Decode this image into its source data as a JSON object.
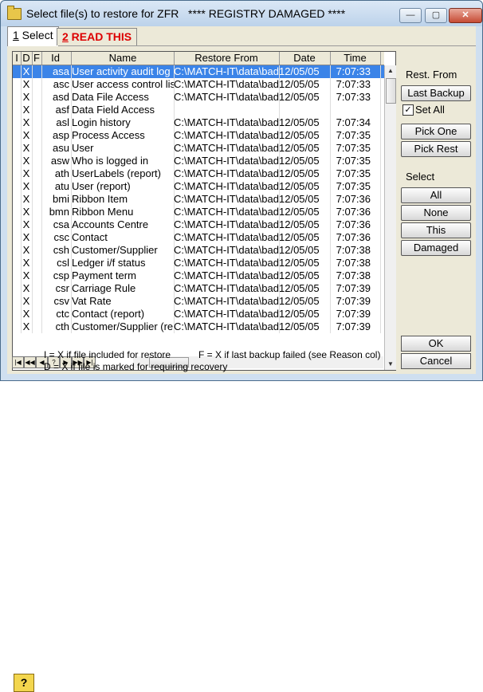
{
  "window": {
    "title": "Select file(s) to restore for ZFR   **** REGISTRY DAMAGED ****",
    "minimize": "—",
    "maximize": "▢",
    "close": "✕"
  },
  "tabs": [
    {
      "number": "1",
      "label": " Select"
    },
    {
      "number": "2",
      "label": " READ THIS"
    }
  ],
  "grid": {
    "headers": [
      "I",
      "D",
      "F",
      "Id",
      "Name",
      "Restore From",
      "Date",
      "Time"
    ],
    "rows": [
      {
        "i": "",
        "d": "X",
        "f": "",
        "id": "asa",
        "name": "User activity audit log",
        "from": "C:\\MATCH-IT\\data\\bad",
        "date": "12/05/05",
        "time": "7:07:33"
      },
      {
        "i": "",
        "d": "X",
        "f": "",
        "id": "asc",
        "name": "User access control list",
        "from": "C:\\MATCH-IT\\data\\bad",
        "date": "12/05/05",
        "time": "7:07:33"
      },
      {
        "i": "",
        "d": "X",
        "f": "",
        "id": "asd",
        "name": "Data File Access",
        "from": "C:\\MATCH-IT\\data\\bad",
        "date": "12/05/05",
        "time": "7:07:33"
      },
      {
        "i": "",
        "d": "X",
        "f": "",
        "id": "asf",
        "name": "Data Field Access",
        "from": "",
        "date": "",
        "time": ""
      },
      {
        "i": "",
        "d": "X",
        "f": "",
        "id": "asl",
        "name": "Login history",
        "from": "C:\\MATCH-IT\\data\\bad",
        "date": "12/05/05",
        "time": "7:07:34"
      },
      {
        "i": "",
        "d": "X",
        "f": "",
        "id": "asp",
        "name": "Process Access",
        "from": "C:\\MATCH-IT\\data\\bad",
        "date": "12/05/05",
        "time": "7:07:35"
      },
      {
        "i": "",
        "d": "X",
        "f": "",
        "id": "asu",
        "name": "User",
        "from": "C:\\MATCH-IT\\data\\bad",
        "date": "12/05/05",
        "time": "7:07:35"
      },
      {
        "i": "",
        "d": "X",
        "f": "",
        "id": "asw",
        "name": "Who is logged in",
        "from": "C:\\MATCH-IT\\data\\bad",
        "date": "12/05/05",
        "time": "7:07:35"
      },
      {
        "i": "",
        "d": "X",
        "f": "",
        "id": "ath",
        "name": "UserLabels (report)",
        "from": "C:\\MATCH-IT\\data\\bad",
        "date": "12/05/05",
        "time": "7:07:35"
      },
      {
        "i": "",
        "d": "X",
        "f": "",
        "id": "atu",
        "name": "User (report)",
        "from": "C:\\MATCH-IT\\data\\bad",
        "date": "12/05/05",
        "time": "7:07:35"
      },
      {
        "i": "",
        "d": "X",
        "f": "",
        "id": "bmi",
        "name": "Ribbon Item",
        "from": "C:\\MATCH-IT\\data\\bad",
        "date": "12/05/05",
        "time": "7:07:36"
      },
      {
        "i": "",
        "d": "X",
        "f": "",
        "id": "bmn",
        "name": "Ribbon Menu",
        "from": "C:\\MATCH-IT\\data\\bad",
        "date": "12/05/05",
        "time": "7:07:36"
      },
      {
        "i": "",
        "d": "X",
        "f": "",
        "id": "csa",
        "name": "Accounts Centre",
        "from": "C:\\MATCH-IT\\data\\bad",
        "date": "12/05/05",
        "time": "7:07:36"
      },
      {
        "i": "",
        "d": "X",
        "f": "",
        "id": "csc",
        "name": "Contact",
        "from": "C:\\MATCH-IT\\data\\bad",
        "date": "12/05/05",
        "time": "7:07:36"
      },
      {
        "i": "",
        "d": "X",
        "f": "",
        "id": "csh",
        "name": "Customer/Supplier",
        "from": "C:\\MATCH-IT\\data\\bad",
        "date": "12/05/05",
        "time": "7:07:38"
      },
      {
        "i": "",
        "d": "X",
        "f": "",
        "id": "csl",
        "name": "Ledger i/f status",
        "from": "C:\\MATCH-IT\\data\\bad",
        "date": "12/05/05",
        "time": "7:07:38"
      },
      {
        "i": "",
        "d": "X",
        "f": "",
        "id": "csp",
        "name": "Payment term",
        "from": "C:\\MATCH-IT\\data\\bad",
        "date": "12/05/05",
        "time": "7:07:38"
      },
      {
        "i": "",
        "d": "X",
        "f": "",
        "id": "csr",
        "name": "Carriage Rule",
        "from": "C:\\MATCH-IT\\data\\bad",
        "date": "12/05/05",
        "time": "7:07:39"
      },
      {
        "i": "",
        "d": "X",
        "f": "",
        "id": "csv",
        "name": "Vat Rate",
        "from": "C:\\MATCH-IT\\data\\bad",
        "date": "12/05/05",
        "time": "7:07:39"
      },
      {
        "i": "",
        "d": "X",
        "f": "",
        "id": "ctc",
        "name": "Contact (report)",
        "from": "C:\\MATCH-IT\\data\\bad",
        "date": "12/05/05",
        "time": "7:07:39"
      },
      {
        "i": "",
        "d": "X",
        "f": "",
        "id": "cth",
        "name": "Customer/Supplier (report)",
        "from": "C:\\MATCH-IT\\data\\bad",
        "date": "12/05/05",
        "time": "7:07:39"
      }
    ]
  },
  "navigator": [
    "|◀",
    "◀◀",
    "◀",
    "?",
    "▶",
    "▶▶",
    "▶|"
  ],
  "panel": {
    "rest_from_label": "Rest. From",
    "last_backup": "Last Backup",
    "set_all_label": "Set All",
    "set_all_checked": "✓",
    "pick_one": "Pick One",
    "pick_rest": "Pick Rest",
    "select_label": "Select",
    "all": "All",
    "none": "None",
    "this": "This",
    "damaged": "Damaged",
    "ok": "OK",
    "cancel": "Cancel"
  },
  "legend": {
    "help": "?",
    "line1a": "I = X if file included for restore",
    "line1b": "F = X if last backup failed (see Reason col)",
    "line2": "D = X if file is marked for requiring recovery"
  }
}
